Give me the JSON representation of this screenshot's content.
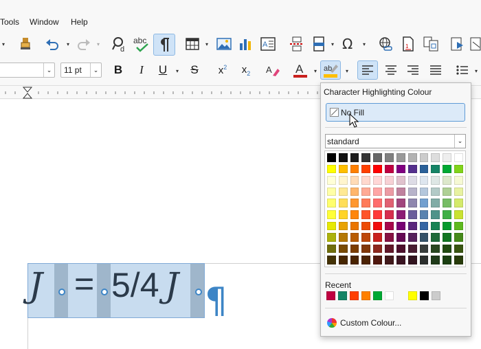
{
  "menubar": {
    "items": [
      "Tools",
      "Window",
      "Help"
    ]
  },
  "toolbar2": {
    "font_size": "11 pt"
  },
  "formula": {
    "left_var": "J",
    "equals": "=",
    "fraction": "5/4",
    "right_var": "J",
    "pilcrow": "¶"
  },
  "popup": {
    "title": "Character Highlighting Colour",
    "no_fill": "No Fill",
    "palette": "standard",
    "recent_label": "Recent",
    "custom": "Custom Colour...",
    "swatches": [
      "#000000",
      "#111111",
      "#1c1c1c",
      "#333333",
      "#666666",
      "#808080",
      "#999999",
      "#b2b2b2",
      "#cccccc",
      "#dddddd",
      "#eeeeee",
      "#ffffff",
      "#ffff00",
      "#ffbf00",
      "#ff8000",
      "#ff4000",
      "#ff0000",
      "#bf0041",
      "#800080",
      "#55308d",
      "#2a6099",
      "#158466",
      "#00a933",
      "#81d41a",
      "#ffffd7",
      "#fff5ce",
      "#ffdbb6",
      "#ffd8ce",
      "#ffd7d7",
      "#f7d1d5",
      "#e0c2cd",
      "#dedce6",
      "#dee6ef",
      "#dee7e5",
      "#dde8cb",
      "#f6f9d4",
      "#ffffa6",
      "#ffe994",
      "#ffb66c",
      "#ffaa95",
      "#ffa6a6",
      "#ec9ba4",
      "#bf819e",
      "#b7b3ca",
      "#b4c7dc",
      "#b3cac7",
      "#afd095",
      "#e8f2a1",
      "#ffff6d",
      "#ffde59",
      "#ff972f",
      "#ff7b59",
      "#ff6d6d",
      "#e16173",
      "#a1467e",
      "#8e86ae",
      "#729fcf",
      "#81aca6",
      "#77bc65",
      "#d4ea6b",
      "#ffff38",
      "#ffd428",
      "#ff860d",
      "#ff5429",
      "#ff3838",
      "#d62e4e",
      "#8d1d75",
      "#6b5e9b",
      "#5983b0",
      "#50938a",
      "#3faf46",
      "#c9e231",
      "#e6e905",
      "#e8a202",
      "#ea7500",
      "#ed4c05",
      "#f10d0c",
      "#a7074b",
      "#780373",
      "#5b277d",
      "#3465a4",
      "#168253",
      "#069a2e",
      "#5eb91e",
      "#acb20c",
      "#b47804",
      "#b85c00",
      "#be480a",
      "#c9211e",
      "#861141",
      "#650953",
      "#55215b",
      "#355269",
      "#1e6a39",
      "#127622",
      "#468a1a",
      "#706e0c",
      "#784b04",
      "#7b3d00",
      "#813709",
      "#8d281e",
      "#611729",
      "#4e102d",
      "#481d32",
      "#383d3c",
      "#28471f",
      "#224b12",
      "#395511",
      "#443205",
      "#472702",
      "#492300",
      "#4b2204",
      "#50180f",
      "#41191b",
      "#3a1421",
      "#32141f",
      "#2b2e2d",
      "#1f3a19",
      "#1b3f12",
      "#283b0b"
    ],
    "recent": [
      "#bf0041",
      "#158466",
      "#ff4000",
      "#ff8000",
      "#00a933",
      "#ffffff",
      "#f7f7f7",
      "#ffff00",
      "#000000",
      "#cccccc"
    ]
  }
}
